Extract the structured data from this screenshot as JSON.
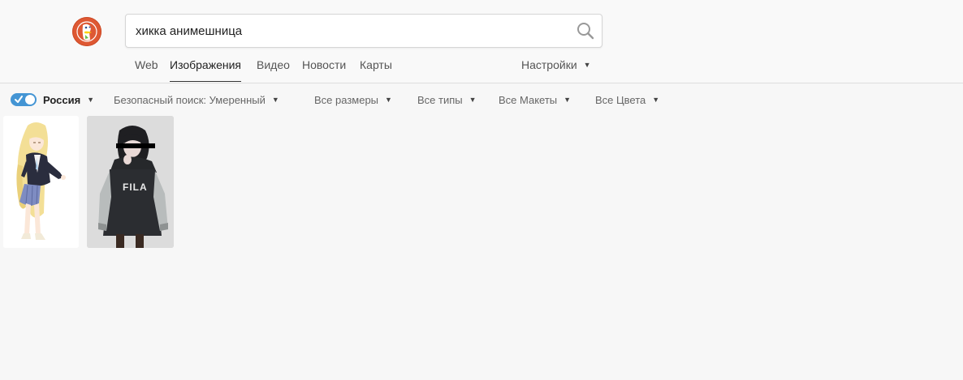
{
  "search": {
    "query": "хикка анимешница"
  },
  "nav": {
    "tabs": [
      {
        "label": "Web"
      },
      {
        "label": "Изображения"
      },
      {
        "label": "Видео"
      },
      {
        "label": "Новости"
      },
      {
        "label": "Карты"
      }
    ],
    "active_tab": "Изображения",
    "settings_label": "Настройки"
  },
  "filters": {
    "region_enabled": true,
    "region_label": "Россия",
    "safe_search_label": "Безопасный поиск: Умеренный",
    "size_label": "Все размеры",
    "type_label": "Все типы",
    "layout_label": "Все Макеты",
    "color_label": "Все Цвета"
  },
  "results": [
    {
      "icon": "anime-girl-blonde-image"
    },
    {
      "icon": "anime-girl-black-hoodie-image"
    }
  ],
  "colors": {
    "brand": "#de5833",
    "toggle": "#4495d4",
    "background": "#f7f7f7"
  }
}
